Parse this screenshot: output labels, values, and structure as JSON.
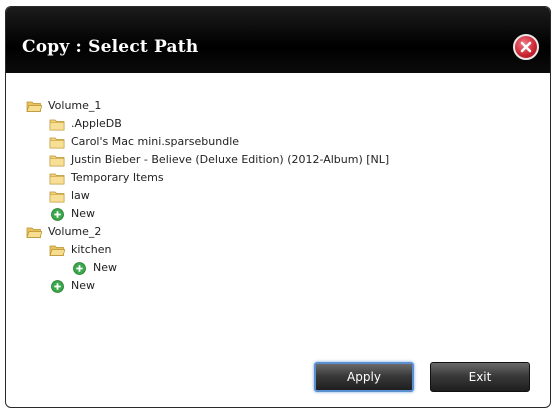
{
  "dialog": {
    "title": "Copy : Select Path",
    "close_icon": "close-icon"
  },
  "tree": [
    {
      "id": "volume-1",
      "label": "Volume_1",
      "type": "folder-open",
      "level": 0
    },
    {
      "id": "appledb",
      "label": ".AppleDB",
      "type": "folder",
      "level": 1
    },
    {
      "id": "carols-mac",
      "label": "Carol's Mac mini.sparsebundle",
      "type": "folder",
      "level": 1
    },
    {
      "id": "justin-bieber",
      "label": "Justin Bieber - Believe (Deluxe Edition) (2012-Album) [NL]",
      "type": "folder",
      "level": 1
    },
    {
      "id": "temporary-items",
      "label": "Temporary Items",
      "type": "folder",
      "level": 1
    },
    {
      "id": "law",
      "label": "law",
      "type": "folder",
      "level": 1
    },
    {
      "id": "new-volume-1",
      "label": "New",
      "type": "new",
      "level": 1
    },
    {
      "id": "volume-2",
      "label": "Volume_2",
      "type": "folder-open",
      "level": 0
    },
    {
      "id": "kitchen",
      "label": "kitchen",
      "type": "folder-open",
      "level": 1
    },
    {
      "id": "new-kitchen",
      "label": "New",
      "type": "new",
      "level": 2
    },
    {
      "id": "new-volume-2",
      "label": "New",
      "type": "new",
      "level": 1
    }
  ],
  "buttons": {
    "apply": "Apply",
    "exit": "Exit"
  },
  "colors": {
    "titlebar": "#000000",
    "close": "#c8232f",
    "folder": "#f2d27a",
    "new": "#3aa84a",
    "apply_border": "#5a8fd0"
  }
}
